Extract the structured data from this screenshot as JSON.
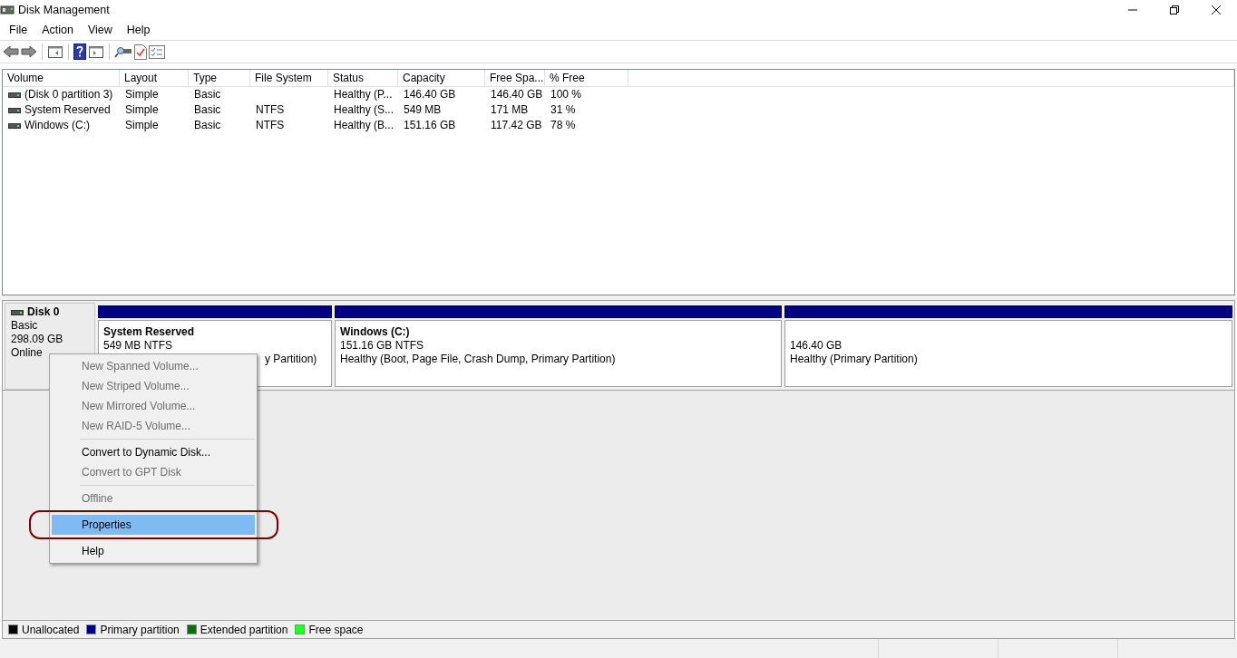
{
  "window": {
    "title": "Disk Management"
  },
  "menu_bar": [
    "File",
    "Action",
    "View",
    "Help"
  ],
  "volumes": {
    "columns": [
      "Volume",
      "Layout",
      "Type",
      "File System",
      "Status",
      "Capacity",
      "Free Spa...",
      "% Free"
    ],
    "rows": [
      [
        "(Disk 0 partition 3)",
        "Simple",
        "Basic",
        "",
        "Healthy (P...",
        "146.40 GB",
        "146.40 GB",
        "100 %"
      ],
      [
        "System Reserved",
        "Simple",
        "Basic",
        "NTFS",
        "Healthy (S...",
        "549 MB",
        "171 MB",
        "31 %"
      ],
      [
        "Windows (C:)",
        "Simple",
        "Basic",
        "NTFS",
        "Healthy (B...",
        "151.16 GB",
        "117.42 GB",
        "78 %"
      ]
    ]
  },
  "disk": {
    "name": "Disk 0",
    "type": "Basic",
    "size": "298.09 GB",
    "status": "Online",
    "partitions": [
      {
        "name": "System Reserved",
        "detail": "549 MB NTFS",
        "status": "y Partition)"
      },
      {
        "name": "Windows  (C:)",
        "detail": "151.16 GB NTFS",
        "status": "Healthy (Boot, Page File, Crash Dump, Primary Partition)"
      },
      {
        "detail": "146.40 GB",
        "status": "Healthy (Primary Partition)"
      }
    ]
  },
  "context_menu": [
    {
      "kind": "item",
      "label": "New Spanned Volume...",
      "disabled": true,
      "selected": false
    },
    {
      "kind": "item",
      "label": "New Striped Volume...",
      "disabled": true,
      "selected": false
    },
    {
      "kind": "item",
      "label": "New Mirrored Volume...",
      "disabled": true,
      "selected": false
    },
    {
      "kind": "item",
      "label": "New RAID-5 Volume...",
      "disabled": true,
      "selected": false
    },
    {
      "kind": "separator"
    },
    {
      "kind": "item",
      "label": "Convert to Dynamic Disk...",
      "disabled": false,
      "selected": false
    },
    {
      "kind": "item",
      "label": "Convert to GPT Disk",
      "disabled": true,
      "selected": false
    },
    {
      "kind": "separator"
    },
    {
      "kind": "item",
      "label": "Offline",
      "disabled": true,
      "selected": false
    },
    {
      "kind": "separator"
    },
    {
      "kind": "item",
      "label": "Properties",
      "disabled": false,
      "selected": true
    },
    {
      "kind": "separator"
    },
    {
      "kind": "item",
      "label": "Help",
      "disabled": false,
      "selected": false
    }
  ],
  "legend": [
    {
      "label": "Unallocated",
      "color": "#000000"
    },
    {
      "label": "Primary partition",
      "color": "#000080"
    },
    {
      "label": "Extended partition",
      "color": "#0a6e0a"
    },
    {
      "label": "Free space",
      "color": "#22ff22"
    }
  ]
}
